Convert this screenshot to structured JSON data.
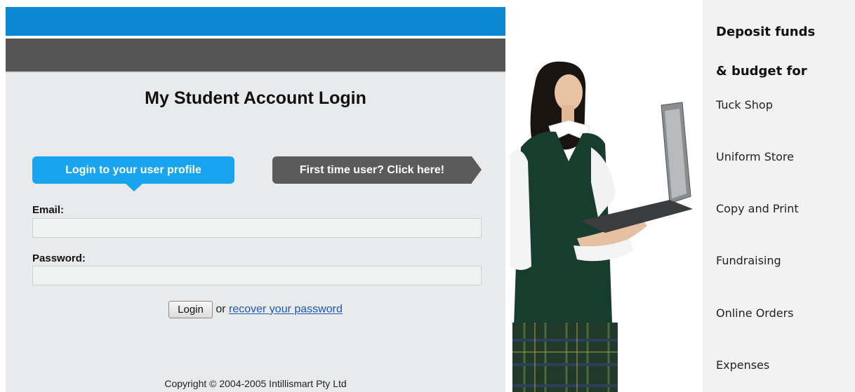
{
  "login": {
    "title": "My Student Account Login",
    "tab_login": "Login to your user profile",
    "tab_first_time": "First time user? Click here!",
    "email_label": "Email:",
    "email_value": "",
    "password_label": "Password:",
    "password_value": "",
    "login_button": "Login",
    "or_text": "or",
    "recover_link": "recover your password",
    "copyright": "Copyright © 2004-2005 Intillismart Pty Ltd"
  },
  "sidebar": {
    "heading_line1": "Deposit funds",
    "heading_line2": "& budget for",
    "items": [
      "Tuck Shop",
      "Uniform Store",
      "Copy and Print",
      "Fundraising",
      "Online Orders",
      "Expenses"
    ]
  },
  "colors": {
    "header_blue": "#0b88d4",
    "header_dark": "#555555",
    "tab_blue": "#19a4ef",
    "tab_grey": "#5b5b5b",
    "link": "#1a55b8"
  }
}
